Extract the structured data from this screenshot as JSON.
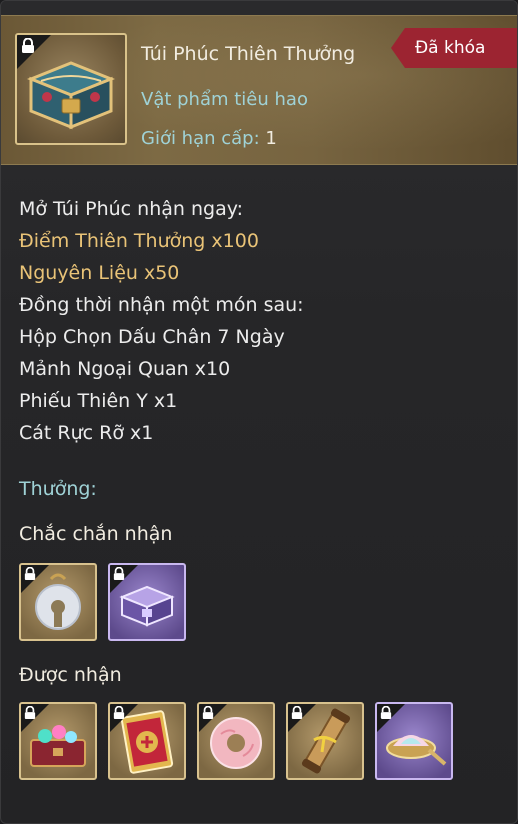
{
  "item": {
    "name": "Túi Phúc Thiên Thưởng",
    "type": "Vật phẩm tiêu hao",
    "level_label": "Giới hạn cấp:",
    "level_value": "1",
    "status_badge": "Đã khóa",
    "icon": "treasure-chest-icon"
  },
  "description": {
    "lines": [
      {
        "text": "Mở Túi Phúc nhận ngay:",
        "style": "normal"
      },
      {
        "text": "Điểm Thiên Thưởng x100",
        "style": "gold"
      },
      {
        "text": "Nguyên Liệu x50",
        "style": "gold"
      },
      {
        "text": "Đồng thời nhận một món sau:",
        "style": "normal"
      },
      {
        "text": "Hộp Chọn Dấu Chân 7 Ngày",
        "style": "normal"
      },
      {
        "text": "Mảnh Ngoại Quan x10",
        "style": "normal"
      },
      {
        "text": "Phiếu Thiên Y x1",
        "style": "normal"
      },
      {
        "text": "Cát Rực Rỡ x1",
        "style": "normal"
      }
    ]
  },
  "rewards": {
    "heading": "Thưởng:",
    "guaranteed_heading": "Chắc chắn nhận",
    "guaranteed": [
      {
        "icon": "jade-pendant-icon",
        "frame": "gold"
      },
      {
        "icon": "purple-chest-icon",
        "frame": "purple"
      }
    ],
    "possible_heading": "Được nhận",
    "possible": [
      {
        "icon": "gem-chest-icon",
        "frame": "gold"
      },
      {
        "icon": "red-ticket-icon",
        "frame": "gold"
      },
      {
        "icon": "pink-jade-ring-icon",
        "frame": "gold"
      },
      {
        "icon": "scroll-icon",
        "frame": "gold"
      },
      {
        "icon": "sand-dish-icon",
        "frame": "purple"
      }
    ]
  },
  "colors": {
    "gold_text": "#e9c377",
    "teal_text": "#9fd2d6",
    "badge_red": "#9c2431",
    "gold_frame": "#d8c28e",
    "purple_frame": "#c9b8f0"
  }
}
